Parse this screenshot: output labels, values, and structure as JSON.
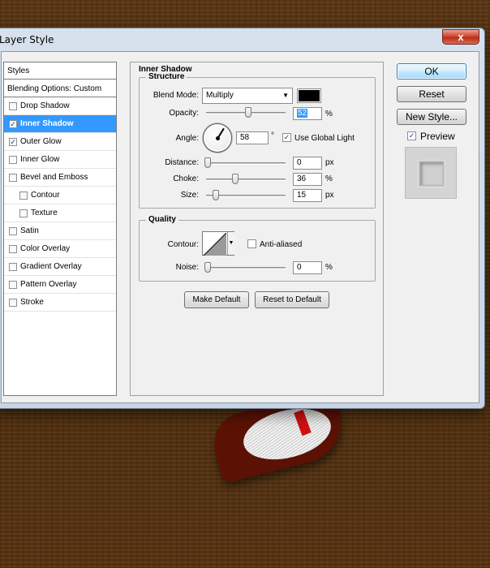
{
  "window": {
    "title": "Layer Style",
    "close_glyph": "x"
  },
  "styles_list": {
    "header": "Styles",
    "blending": "Blending Options: Custom",
    "items": [
      {
        "label": "Drop Shadow",
        "checked": false,
        "sub": false,
        "selected": false
      },
      {
        "label": "Inner Shadow",
        "checked": true,
        "sub": false,
        "selected": true
      },
      {
        "label": "Outer Glow",
        "checked": true,
        "sub": false,
        "selected": false
      },
      {
        "label": "Inner Glow",
        "checked": false,
        "sub": false,
        "selected": false
      },
      {
        "label": "Bevel and Emboss",
        "checked": false,
        "sub": false,
        "selected": false
      },
      {
        "label": "Contour",
        "checked": false,
        "sub": true,
        "selected": false
      },
      {
        "label": "Texture",
        "checked": false,
        "sub": true,
        "selected": false
      },
      {
        "label": "Satin",
        "checked": false,
        "sub": false,
        "selected": false
      },
      {
        "label": "Color Overlay",
        "checked": false,
        "sub": false,
        "selected": false
      },
      {
        "label": "Gradient Overlay",
        "checked": false,
        "sub": false,
        "selected": false
      },
      {
        "label": "Pattern Overlay",
        "checked": false,
        "sub": false,
        "selected": false
      },
      {
        "label": "Stroke",
        "checked": false,
        "sub": false,
        "selected": false
      }
    ]
  },
  "panel": {
    "title": "Inner Shadow",
    "structure": {
      "legend": "Structure",
      "blend_mode_label": "Blend Mode:",
      "blend_mode_value": "Multiply",
      "shadow_color": "#000000",
      "opacity_label": "Opacity:",
      "opacity_value": "52",
      "opacity_unit": "%",
      "angle_label": "Angle:",
      "angle_value": "58",
      "angle_unit": "°",
      "use_global_light_label": "Use Global Light",
      "use_global_light": true,
      "distance_label": "Distance:",
      "distance_value": "0",
      "distance_unit": "px",
      "choke_label": "Choke:",
      "choke_value": "36",
      "choke_unit": "%",
      "size_label": "Size:",
      "size_value": "15",
      "size_unit": "px"
    },
    "quality": {
      "legend": "Quality",
      "contour_label": "Contour:",
      "anti_aliased_label": "Anti-aliased",
      "anti_aliased": false,
      "noise_label": "Noise:",
      "noise_value": "0",
      "noise_unit": "%"
    },
    "make_default": "Make Default",
    "reset_default": "Reset to Default"
  },
  "right": {
    "ok": "OK",
    "reset": "Reset",
    "new_style": "New Style...",
    "preview_label": "Preview",
    "preview_checked": true
  },
  "icons": {
    "check": "check-icon",
    "dropdown": "triangle-down-icon",
    "close": "close-icon"
  }
}
